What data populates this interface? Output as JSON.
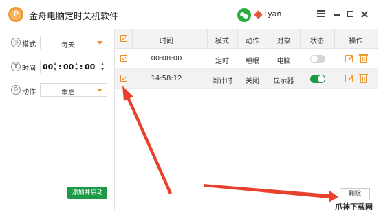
{
  "app": {
    "title": "金舟电脑定时关机软件",
    "logo_letter": "P",
    "user_name": "Lyan"
  },
  "form": {
    "mode_label": "模式",
    "mode_value": "每天",
    "time_label": "时间",
    "time_hh": "00",
    "time_mm": "00",
    "time_ss": "00",
    "action_label": "动作",
    "action_value": "重启",
    "add_button": "添加并启动"
  },
  "table": {
    "headers": [
      "时间",
      "模式",
      "动作",
      "对象",
      "状态",
      "操作"
    ],
    "rows": [
      {
        "time": "00:08:00",
        "mode": "定时",
        "action": "睡眠",
        "target": "电脑",
        "checked": true,
        "enabled": false
      },
      {
        "time": "14:58:12",
        "mode": "倒计时",
        "action": "关闭",
        "target": "显示器",
        "checked": true,
        "enabled": true
      }
    ]
  },
  "delete_button": "删除",
  "watermark": "爪神下载网",
  "colors": {
    "accent": "#f08a24",
    "green": "#1d9a47",
    "arrow": "#e8412c"
  },
  "icons": [
    "app-logo-icon",
    "wechat-icon",
    "user-badge-icon",
    "menu-icon",
    "minimize-icon",
    "maximize-icon",
    "close-icon",
    "clock-icon",
    "time-icon",
    "action-icon",
    "edit-icon",
    "trash-icon"
  ]
}
